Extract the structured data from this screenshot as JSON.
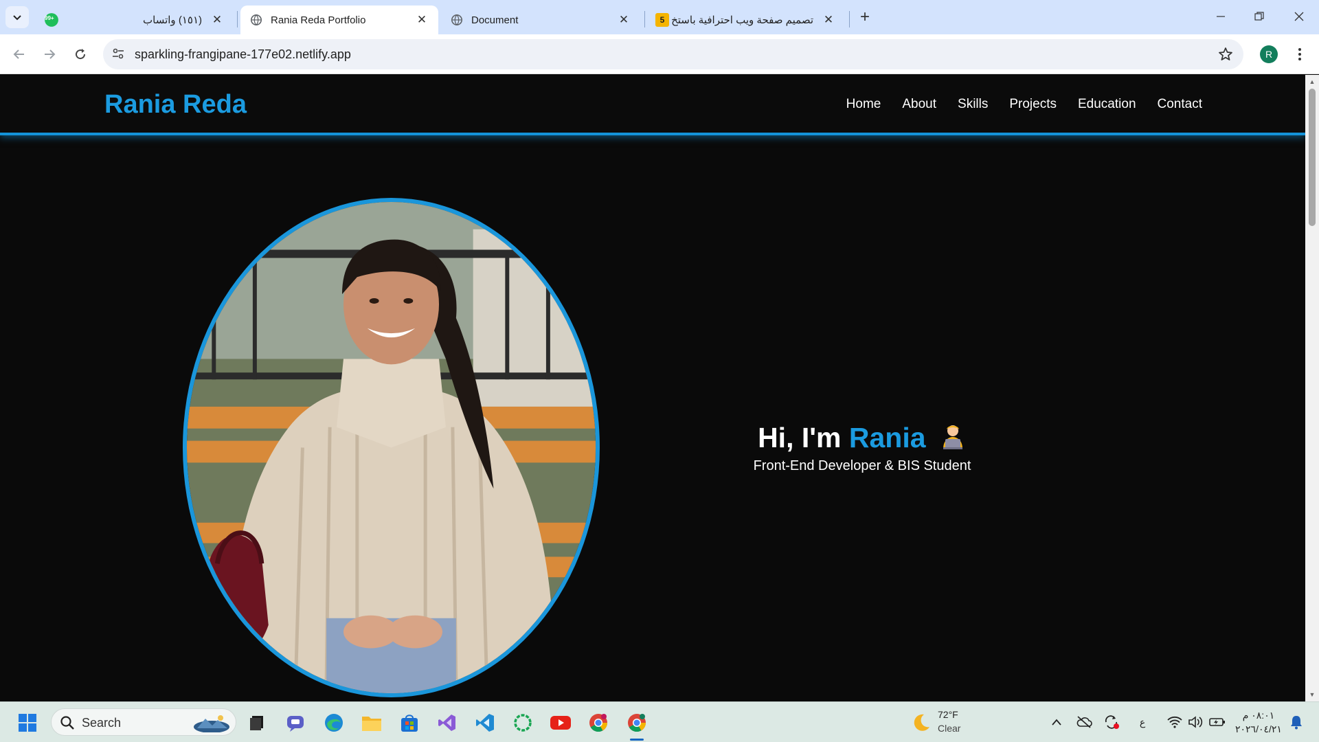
{
  "browser": {
    "tabs": [
      {
        "title": "(١٥١) واتساب",
        "badge": "99+"
      },
      {
        "title": "Rania Reda Portfolio"
      },
      {
        "title": "Document"
      },
      {
        "title": "تصميم صفحة ويب احترافية باستخ",
        "badge": "5"
      }
    ],
    "url": "sparkling-frangipane-177e02.netlify.app",
    "profile_initial": "R"
  },
  "site": {
    "brand": "Rania Reda",
    "nav": [
      "Home",
      "About",
      "Skills",
      "Projects",
      "Education",
      "Contact"
    ],
    "hero": {
      "greeting": "Hi, I'm",
      "name": "Rania",
      "subtitle": "Front-End Developer & BIS Student"
    },
    "accent": "#1b9be0"
  },
  "taskbar": {
    "search_label": "Search",
    "weather": {
      "temp": "72°F",
      "condition": "Clear"
    },
    "ime": "ع",
    "clock": {
      "time": "٠٨:٠١ م",
      "date": "٢٠٢٦/٠٤/٢١"
    },
    "apps": [
      "windows-start",
      "task-view",
      "teams-chat",
      "edge",
      "file-explorer",
      "ms-store",
      "visual-studio",
      "vscode",
      "spinner-app",
      "youtube",
      "chrome",
      "chrome-profile"
    ]
  }
}
